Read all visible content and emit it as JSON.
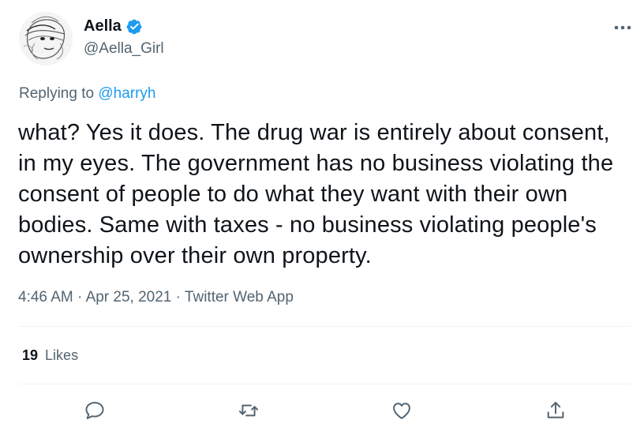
{
  "author": {
    "display_name": "Aella",
    "handle": "@Aella_Girl",
    "verified": true
  },
  "reply": {
    "prefix": "Replying to",
    "mention": "@harryh"
  },
  "tweet": {
    "text": "what? Yes it does. The drug war is entirely about consent, in my eyes. The government has no business violating the consent of people to do what they want with their own bodies. Same with taxes - no business violating people's ownership over their own property.",
    "time": "4:46 AM",
    "date": "Apr 25, 2021",
    "source": "Twitter Web App",
    "separator": "·"
  },
  "stats": {
    "likes_count": "19",
    "likes_label": "Likes"
  },
  "icons": {
    "more": "more-horizontal-icon",
    "reply": "reply-icon",
    "retweet": "retweet-icon",
    "like": "heart-icon",
    "share": "share-icon",
    "verified": "verified-badge-icon"
  },
  "colors": {
    "accent": "#1d9bf0",
    "text": "#0f1419",
    "secondary": "#536471",
    "divider": "#eff3f4"
  }
}
